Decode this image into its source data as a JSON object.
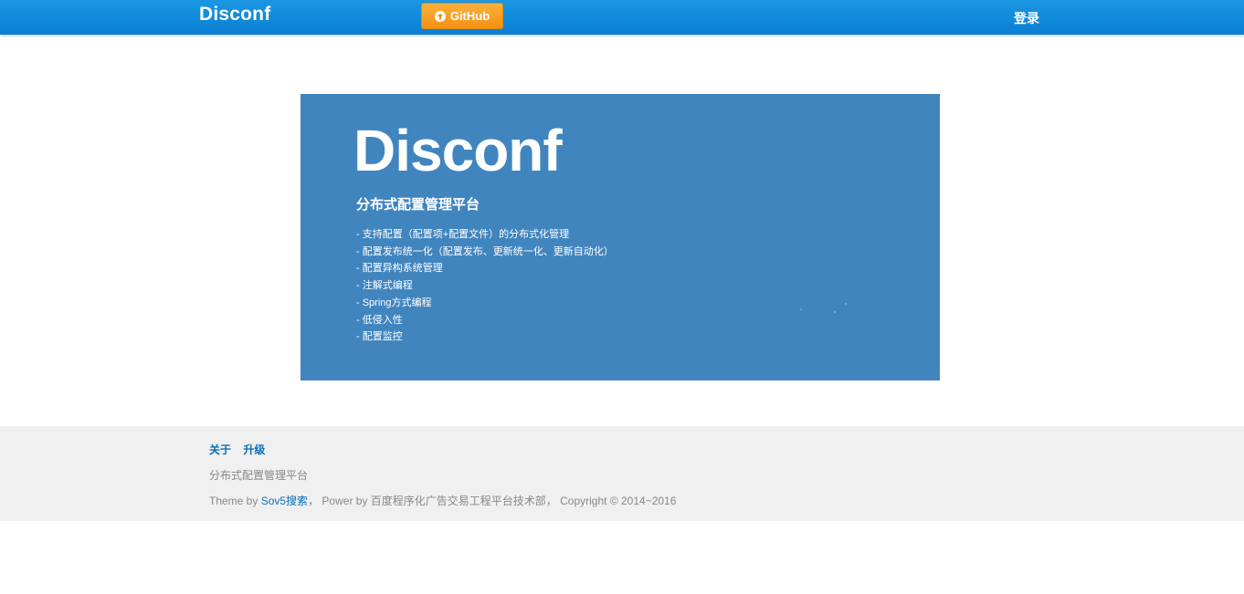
{
  "navbar": {
    "brand": "Disconf",
    "github_label": "GitHub",
    "login_label": "登录",
    "colors": {
      "bar": "#0b7ed3",
      "github_button": "#f39214"
    }
  },
  "banner": {
    "title": "Disconf",
    "subtitle": "分布式配置管理平台",
    "features": [
      "- 支持配置（配置项+配置文件）的分布式化管理",
      "- 配置发布统一化（配置发布、更新统一化、更新自动化）",
      "- 配置异构系统管理",
      "- 注解式编程",
      "- Spring方式编程",
      "- 低侵入性",
      "- 配置监控"
    ],
    "background_color": "#4185bf"
  },
  "footer": {
    "links": [
      "关于",
      "升级"
    ],
    "description": "分布式配置管理平台",
    "credit": {
      "theme_prefix": "Theme by",
      "theme_link": "Sov5搜索",
      "sep": "，",
      "power": "Power by 百度程序化广告交易工程平台技术部，",
      "copyright": "Copyright © 2014~2016"
    }
  }
}
